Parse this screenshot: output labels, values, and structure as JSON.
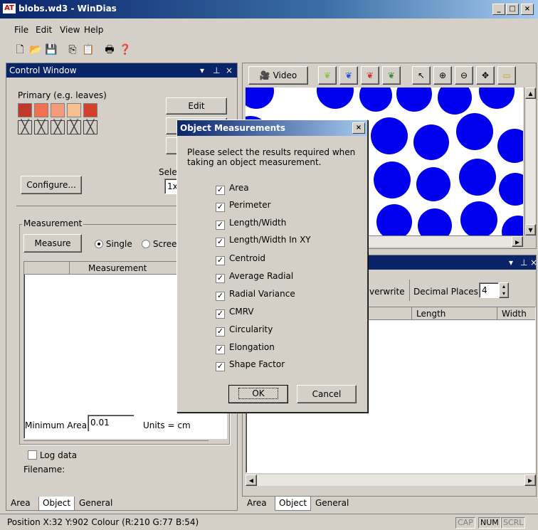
{
  "window": {
    "logo": "AT",
    "title": "blobs.wd3 - WinDias",
    "minimize": "_",
    "maximize": "□",
    "close": "×"
  },
  "menu": [
    "File",
    "Edit",
    "View",
    "Help"
  ],
  "control": {
    "title": "Control Window",
    "primary_label": "Primary (e.g. leaves)",
    "swatch_colors": [
      "#c0392b",
      "#f07050",
      "#f59a7a",
      "#f8c090",
      "#d0402c"
    ],
    "edit_button": "Edit",
    "select_label": "Selec",
    "select_value": "1x",
    "configure_button": "Configure...",
    "measurement_group": "Measurement",
    "measure_button": "Measure",
    "radio_single": "Single",
    "radio_screen": "Screen",
    "table_header": "Measurement",
    "min_area_label": "Minimum Area",
    "min_area_value": "0.01",
    "units_label": "Units = cm",
    "log_data_label": "Log data",
    "filename_label": "Filename:"
  },
  "left_tabs": [
    "Area",
    "Object",
    "General"
  ],
  "video": {
    "label": "Video"
  },
  "results": {
    "overwrite_label": "verwrite",
    "decimal_label": "Decimal Places",
    "decimal_value": "4",
    "col_length": "Length",
    "col_width": "Width"
  },
  "right_tabs": [
    "Area",
    "Object",
    "General"
  ],
  "dialog": {
    "title": "Object Measurements",
    "close": "×",
    "instructions": "Please select the results required when taking an object measurement.",
    "options": [
      "Area",
      "Perimeter",
      "Length/Width",
      "Length/Width In XY",
      "Centroid",
      "Average Radial",
      "Radial Variance",
      "CMRV",
      "Circularity",
      "Elongation",
      "Shape Factor"
    ],
    "ok": "OK",
    "cancel": "Cancel"
  },
  "status": {
    "text": "Position  X:32 Y:902  Colour (R:210 G:77 B:54)",
    "cap": "CAP",
    "num": "NUM",
    "scrl": "SCRL"
  }
}
